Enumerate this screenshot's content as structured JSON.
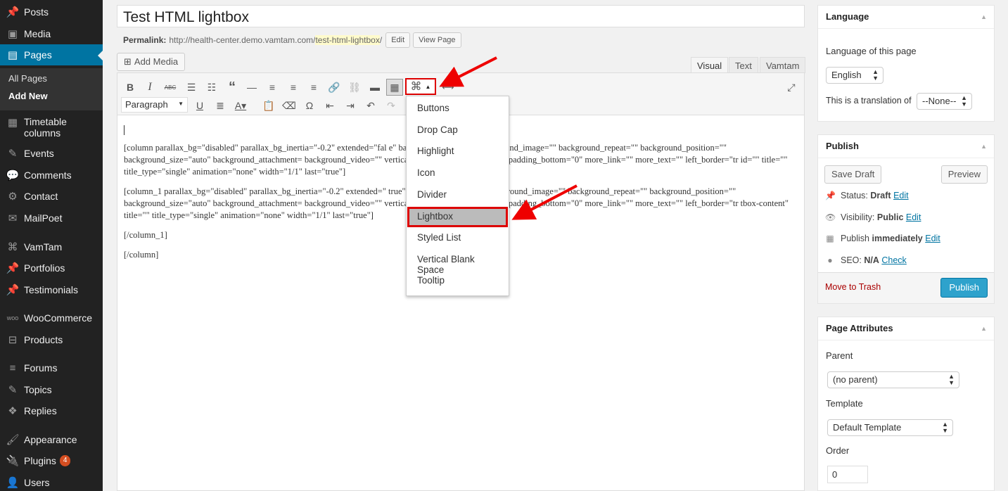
{
  "sidebar": {
    "items": [
      {
        "label": "Posts",
        "icon": "pin-icon"
      },
      {
        "label": "Media",
        "icon": "media-icon"
      },
      {
        "label": "Pages",
        "icon": "pages-icon"
      },
      {
        "label": "Timetable columns",
        "icon": "timetable-icon"
      },
      {
        "label": "Events",
        "icon": "events-icon"
      },
      {
        "label": "Comments",
        "icon": "comments-icon"
      },
      {
        "label": "Contact",
        "icon": "gear-icon"
      },
      {
        "label": "MailPoet",
        "icon": "mail-icon"
      },
      {
        "label": "VamTam",
        "icon": "vamtam-icon"
      },
      {
        "label": "Portfolios",
        "icon": "pin-icon"
      },
      {
        "label": "Testimonials",
        "icon": "pin-icon"
      },
      {
        "label": "WooCommerce",
        "icon": "woo-icon"
      },
      {
        "label": "Products",
        "icon": "products-icon"
      },
      {
        "label": "Forums",
        "icon": "forums-icon"
      },
      {
        "label": "Topics",
        "icon": "topics-icon"
      },
      {
        "label": "Replies",
        "icon": "replies-icon"
      },
      {
        "label": "Appearance",
        "icon": "brush-icon"
      },
      {
        "label": "Plugins",
        "icon": "plugin-icon",
        "badge": "4"
      },
      {
        "label": "Users",
        "icon": "users-icon"
      }
    ],
    "sub": {
      "all_pages": "All Pages",
      "add_new": "Add New"
    }
  },
  "editor": {
    "title": "Test HTML lightbox",
    "permalink_label": "Permalink:",
    "permalink_base": "http://health-center.demo.vamtam.com/",
    "permalink_slug": "test-html-lightbox",
    "permalink_end": "/",
    "edit_btn": "Edit",
    "view_btn": "View Page",
    "add_media": "Add Media",
    "tabs": [
      "Visual",
      "Text",
      "Vamtam"
    ],
    "format": "Paragraph",
    "content": [
      "[column parallax_bg=\"disabled\" parallax_bg_inertia=\"-0.2\" extended=\"fal                                                              e\" background_color=\"\" background_image=\"\" background_repeat=\"\" background_position=\"\" background_size=\"auto\" background_attachment=                                    background_video=\"\" vertical_padding_top=\"0\" vertical_padding_bottom=\"0\" more_link=\"\" more_text=\"\" left_border=\"tr                                   id=\"\" title=\"\" title_type=\"single\" animation=\"none\" width=\"1/1\" last=\"true\"]",
      "[column_1 parallax_bg=\"disabled\" parallax_bg_inertia=\"-0.2\" extended=\"                                   true\" background_color=\"\" background_image=\"\" background_repeat=\"\" background_position=\"\" background_size=\"auto\" background_attachment=                                    background_video=\"\" vertical_padding_top=\"0\" vertical_padding_bottom=\"0\" more_link=\"\" more_text=\"\" left_border=\"tr                                   tbox-content\" title=\"\" title_type=\"single\" animation=\"none\" width=\"1/1\" last=\"true\"]",
      "[/column_1]",
      "[/column]"
    ]
  },
  "dropdown": {
    "items": [
      "Buttons",
      "Drop Cap",
      "Highlight",
      "Icon",
      "Divider",
      "Lightbox",
      "Styled List",
      "Vertical Blank Space",
      "Tooltip"
    ],
    "selected": "Lightbox"
  },
  "language_box": {
    "title": "Language",
    "label": "Language of this page",
    "value": "English",
    "translation_label": "This is a translation of",
    "translation_value": "--None--"
  },
  "publish_box": {
    "title": "Publish",
    "save_draft": "Save Draft",
    "preview": "Preview",
    "status_label": "Status:",
    "status_value": "Draft",
    "visibility_label": "Visibility:",
    "visibility_value": "Public",
    "publish_label": "Publish",
    "publish_value": "immediately",
    "seo_label": "SEO:",
    "seo_value": "N/A",
    "seo_check": "Check",
    "edit": "Edit",
    "trash": "Move to Trash",
    "publish_btn": "Publish"
  },
  "attributes_box": {
    "title": "Page Attributes",
    "parent_label": "Parent",
    "parent_value": "(no parent)",
    "template_label": "Template",
    "template_value": "Default Template",
    "order_label": "Order",
    "order_value": "0"
  },
  "colors": {
    "accent": "#0074a2",
    "highlight": "#d00000",
    "publish": "#2ea2cc"
  }
}
